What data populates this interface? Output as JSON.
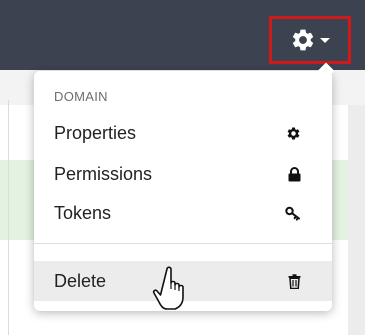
{
  "menu": {
    "header": "DOMAIN",
    "items": [
      {
        "label": "Properties",
        "icon": "gear-icon"
      },
      {
        "label": "Permissions",
        "icon": "lock-icon"
      },
      {
        "label": "Tokens",
        "icon": "key-icon"
      }
    ],
    "delete": {
      "label": "Delete",
      "icon": "trash-icon"
    }
  },
  "toolbar": {
    "trigger_icon": "gear-icon",
    "caret_icon": "caret-down-icon"
  },
  "colors": {
    "topbar": "#3c4250",
    "highlight_border": "#d01919",
    "hover_row": "#ececec",
    "green_strip": "#e4f2e1"
  }
}
